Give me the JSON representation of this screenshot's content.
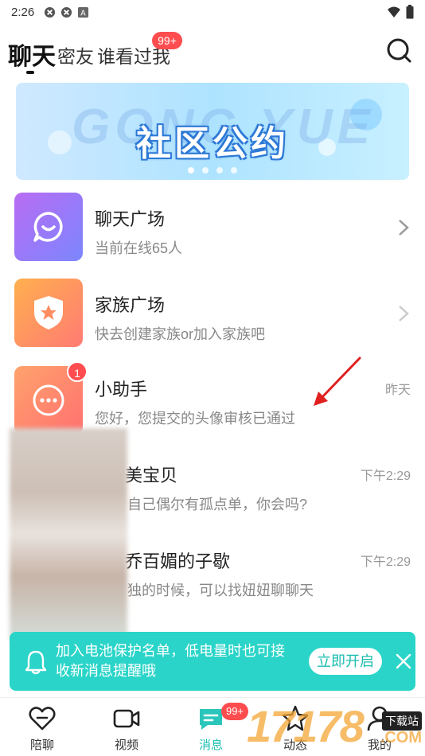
{
  "status_bar": {
    "time": "2:26"
  },
  "header": {
    "tabs": [
      {
        "label": "聊天"
      },
      {
        "label": "密友"
      },
      {
        "label": "谁看过我"
      }
    ],
    "visitors_badge": "99+"
  },
  "banner": {
    "title": "社区公约",
    "bg_text": "GONG YUE"
  },
  "conversations": [
    {
      "title": "聊天广场",
      "subtitle": "当前在线65人"
    },
    {
      "title": "家族广场",
      "subtitle": "快去创建家族or加入家族吧"
    },
    {
      "title": "小助手",
      "subtitle": "您好，您提交的头像审核已通过",
      "time": "昨天",
      "unread": "1"
    },
    {
      "title": "美宝贝",
      "subtitle": "自己偶尔有孤点单，你会吗?",
      "time": "下午2:29"
    },
    {
      "title": "乔百媚的子歇",
      "subtitle": "独的时候，可以找妞妞聊聊天",
      "time": "下午2:29"
    }
  ],
  "notice": {
    "text": "加入电池保护名单，低电量时也可接收新消息提醒哦",
    "button": "立即开启"
  },
  "bottom_nav": {
    "items": [
      {
        "label": "陪聊"
      },
      {
        "label": "视频"
      },
      {
        "label": "消息"
      },
      {
        "label": "动态"
      },
      {
        "label": "我的"
      }
    ],
    "messages_badge": "99+"
  },
  "watermark": {
    "digits": "17178",
    "tag": "下载站",
    "com": ".COM"
  },
  "colors": {
    "accent": "#19bfb3",
    "badge": "#ff4d4f",
    "notice_bg": "#2ad4c8"
  }
}
